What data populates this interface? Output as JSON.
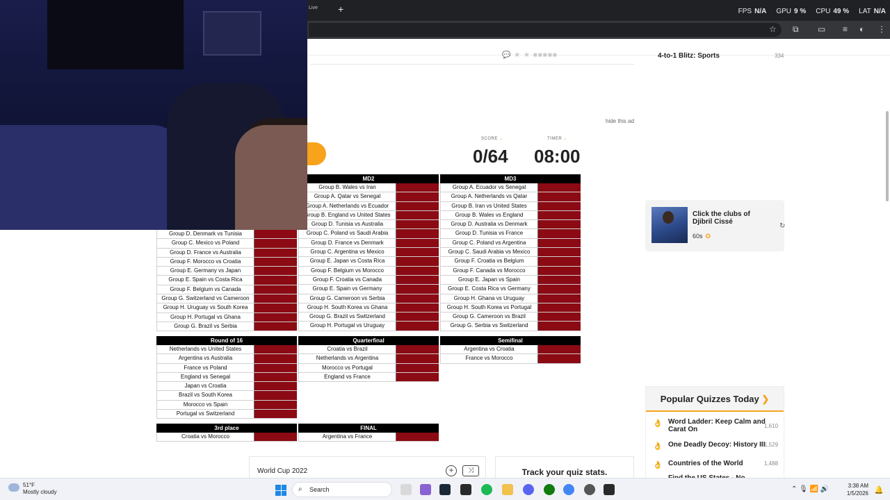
{
  "browser": {
    "tab_fragment": "Live",
    "new_tab": "+",
    "perf": [
      {
        "label": "FPS",
        "value": "N/A"
      },
      {
        "label": "GPU",
        "value": "9 %"
      },
      {
        "label": "CPU",
        "value": "49 %"
      },
      {
        "label": "LAT",
        "value": "N/A"
      }
    ],
    "close": "✕"
  },
  "page": {
    "top_sidebar_item": "4-to-1 Blitz: Sports",
    "top_sidebar_count": "334",
    "hide_ad": "hide this ad",
    "score": {
      "label": "SCORE",
      "value": "0/64"
    },
    "timer": {
      "label": "TIMER",
      "value": "08:00"
    }
  },
  "tables": {
    "md1_partial": [
      "Group D. Denmark vs Tunisia",
      "Group C. Mexico vs Poland",
      "Group D. France vs Australia",
      "Group F. Morocco vs Croatia",
      "Group E. Germany vs Japan",
      "Group E. Spain vs Costa Rica",
      "Group F. Belgium vs Canada",
      "Group G. Switzerland vs Cameroon",
      "Group H. Uruguay vs South Korea",
      "Group H. Portugal vs Ghana",
      "Group G. Brazil vs Serbia"
    ],
    "md2": {
      "title": "MD2",
      "rows": [
        "Group B. Wales vs Iran",
        "Group A. Qatar vs Senegal",
        "Group A. Netherlands vs Ecuador",
        "Group B. England vs United States",
        "Group D. Tunisia vs Australia",
        "Group C. Poland vs Saudi Arabia",
        "Group D. France vs Denmark",
        "Group C. Argentina vs Mexico",
        "Group E. Japan vs Costa Rica",
        "Group F. Belgium vs Morocco",
        "Group F. Croatia vs Canada",
        "Group E. Spain vs Germany",
        "Group G. Cameroon vs Serbia",
        "Group H. South Korea vs Ghana",
        "Group G. Brazil vs Switzerland",
        "Group H. Portugal vs Uruguay"
      ]
    },
    "md3": {
      "title": "MD3",
      "rows": [
        "Group A. Ecuador vs Senegal",
        "Group A. Netherlands vs Qatar",
        "Group B. Iran vs United States",
        "Group B. Wales vs England",
        "Group D. Australia vs Denmark",
        "Group D. Tunisia vs France",
        "Group C. Poland vs Argentina",
        "Group C. Saudi Arabia vs Mexico",
        "Group F. Croatia vs Belgium",
        "Group F. Canada vs Morocco",
        "Group E. Japan vs Spain",
        "Group E. Costa Rica vs Germany",
        "Group H. Ghana vs Uruguay",
        "Group H. South Korea vs Portugal",
        "Group G. Cameroon vs Brazil",
        "Group G. Serbia vs Switzerland"
      ]
    },
    "r16": {
      "title": "Round of 16",
      "rows": [
        "Netherlands vs United States",
        "Argentina vs Australia",
        "France vs Poland",
        "England vs Senegal",
        "Japan vs Croatia",
        "Brazil vs South Korea",
        "Morocco vs Spain",
        "Portugal vs Switzerland"
      ]
    },
    "qf": {
      "title": "Quarterfinal",
      "rows": [
        "Croatia vs Brazil",
        "Netherlands vs Argentina",
        "Morocco vs Portugal",
        "England vs France"
      ]
    },
    "sf": {
      "title": "Semifinal",
      "rows": [
        "Argentina vs Croatia",
        "France vs Morocco"
      ]
    },
    "third": {
      "title": "3rd place",
      "rows": [
        "Croatia vs Morocco"
      ]
    },
    "final": {
      "title": "FINAL",
      "rows": [
        "Argentina vs France"
      ]
    }
  },
  "sidebar": {
    "quiz_card": {
      "title": "Click the clubs of Djibril Cissé",
      "time": "60s"
    },
    "popular": {
      "title": "Popular Quizzes Today",
      "items": [
        {
          "name": "Word Ladder: Keep Calm and Carat On",
          "count": "1,610"
        },
        {
          "name": "One Deadly Decoy: History III",
          "count": "1,529"
        },
        {
          "name": "Countries of the World",
          "count": "1,488"
        },
        {
          "name": "Find the US States - No",
          "count": ""
        }
      ]
    }
  },
  "bottom": {
    "quiz_title": "World Cup 2022",
    "track": "Track your quiz stats."
  },
  "taskbar": {
    "temp": "51°F",
    "weather": "Mostly cloudy",
    "search": "Search",
    "time": "3:38 AM",
    "date": "1/5/2026"
  }
}
